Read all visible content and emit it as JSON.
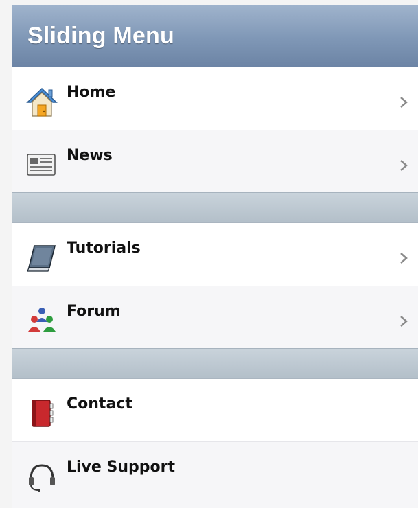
{
  "header": {
    "title": "Sliding Menu"
  },
  "menu": {
    "items": [
      {
        "label": "Home",
        "icon": "home-icon"
      },
      {
        "label": "News",
        "icon": "news-icon"
      },
      {
        "label": "Tutorials",
        "icon": "book-icon"
      },
      {
        "label": "Forum",
        "icon": "users-icon"
      },
      {
        "label": "Contact",
        "icon": "address-book-icon"
      },
      {
        "label": "Live Support",
        "icon": "headset-icon"
      }
    ]
  },
  "colors": {
    "header_top": "#9fb3cc",
    "header_bottom": "#6c84a5",
    "divider": "#b3bfc9",
    "chevron": "#8a8a8a"
  }
}
